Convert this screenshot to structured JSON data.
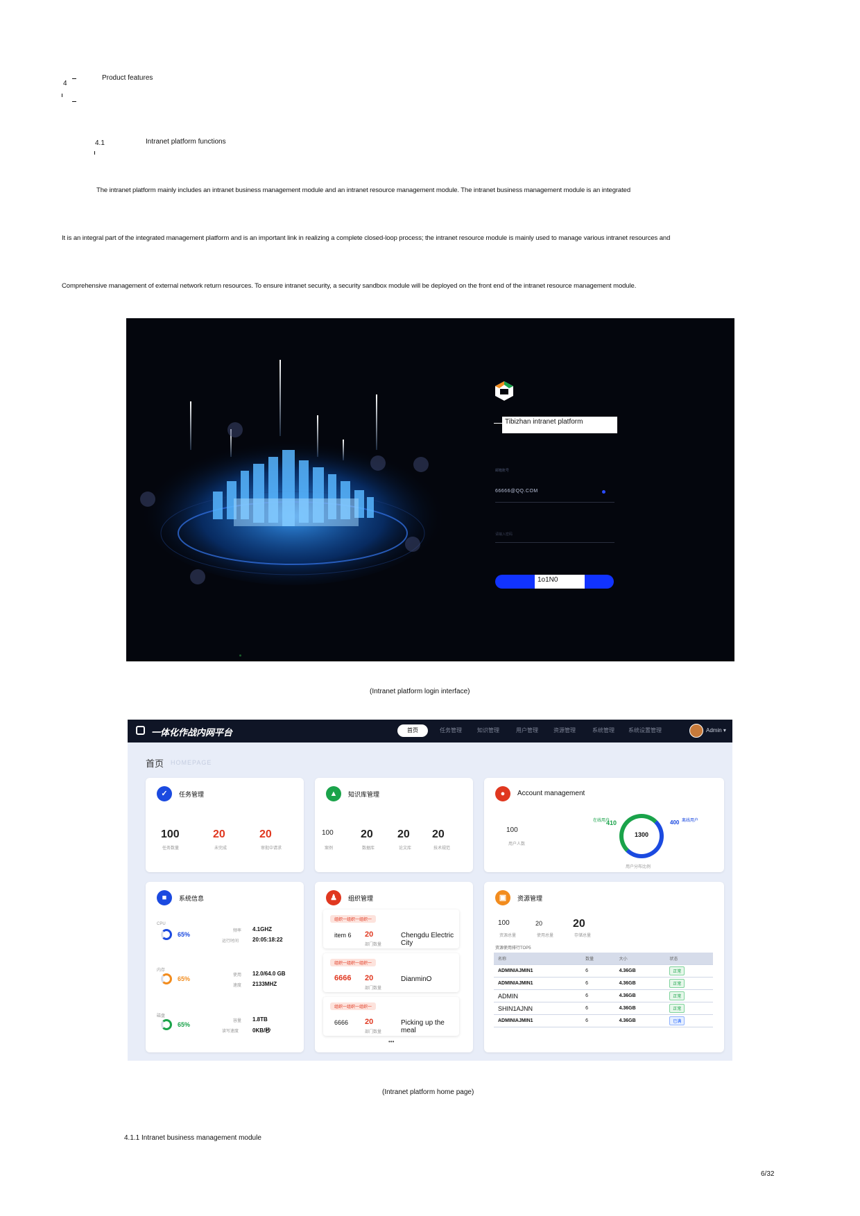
{
  "section4": {
    "number": "4",
    "title": "Product features"
  },
  "section41": {
    "number": "4.1",
    "title": "Intranet platform functions"
  },
  "paragraph": {
    "line1": "The intranet platform mainly includes an intranet business management module and an intranet resource management module. The intranet business management module is an integrated",
    "line2": "It is an integral part of the integrated management platform and is an important link in realizing a complete closed-loop process; the intranet resource module is mainly used to manage various intranet resources and",
    "line3": "Comprehensive management of external network return resources. To ensure intranet security, a security sandbox module will be deployed on the front end of the intranet resource management module."
  },
  "login": {
    "platform_name": "Tibizhan intranet platform",
    "email_value": "66666@QQ.COM",
    "button_label": "1o1N0",
    "caption": "(Intranet platform login interface)"
  },
  "dashboard": {
    "brand": "一体化作战内网平台",
    "nav": [
      "首页",
      "任务管理",
      "知识管理",
      "用户管理",
      "资源管理",
      "系统管理",
      "系统设置管理"
    ],
    "user": "Admin ▾",
    "page_title": "首页",
    "page_subtitle": "HOMEPAGE",
    "task": {
      "title": "任务管理",
      "v1": "100",
      "v2": "20",
      "v3": "20",
      "l1": "任务数量",
      "l2": "未完成",
      "l3": "审批中请求"
    },
    "knowledge": {
      "title": "知识库管理",
      "v1": "100",
      "v2": "20",
      "v3": "20",
      "v4": "20",
      "l1": "案例",
      "l2": "数据库",
      "l3": "论文库",
      "l4": "技术规范"
    },
    "account": {
      "title": "Account management",
      "v1": "100",
      "l1": "用户人数",
      "left_num": "410",
      "right_num": "400",
      "center": "1300",
      "ring_label": "用户分布比例",
      "left_tag": "在线用户",
      "right_tag": "离线用户"
    },
    "system": {
      "title": "系统信息",
      "cpu": "CPU",
      "mem": "内存",
      "disk": "磁盘",
      "pct1": "65%",
      "pct2": "65%",
      "pct3": "65%",
      "k1": "频率",
      "v1": "4.1GHZ",
      "k2": "运行时间",
      "v2": "20:05:18:22",
      "k3": "使用",
      "v3": "12.0/64.0 GB",
      "k4": "速度",
      "v4": "2133MHZ",
      "k5": "容量",
      "v5": "1.8TB",
      "k6": "读写速度",
      "v6": "0KB/秒"
    },
    "org": {
      "title": "组织管理",
      "tag1": "组织一组织一组织一",
      "a1": "item 6",
      "n1": "20",
      "name1": "Chengdu Electric City",
      "tag2": "组织一组织一组织一",
      "a2": "6666",
      "n2": "20",
      "name2": "DianminO",
      "tag3": "组织一组织一组织一",
      "a3": "6666",
      "n3": "20",
      "name3": "Picking up the meal",
      "sub": "部门数量",
      "more": "•••"
    },
    "resource": {
      "title": "资源管理",
      "v1": "100",
      "v2": "20",
      "v3": "20",
      "l1": "资源总量",
      "l2": "使用总量",
      "l3": "存储总量",
      "table_title": "资源使用排行TOP5",
      "headers": [
        "名称",
        "数量",
        "大小",
        "状态"
      ],
      "rows": [
        {
          "name": "ADMINIAJMIN1",
          "count": "6",
          "size": "4.36GB",
          "status": "正常"
        },
        {
          "name": "ADMINIAJMIN1",
          "count": "6",
          "size": "4.36GB",
          "status": "正常"
        },
        {
          "name": "ADMIN",
          "count": "6",
          "size": "4.36GB",
          "status": "正常"
        },
        {
          "name": "SHIN1AJNN",
          "count": "6",
          "size": "4.36GB",
          "status": "正常"
        },
        {
          "name": "ADMINIAJMIN1",
          "count": "6",
          "size": "4.36GB",
          "status": "已满"
        }
      ]
    },
    "caption": "(Intranet platform home page)"
  },
  "subsection": "4.1.1 Intranet business management module",
  "page_number": "6/32",
  "colors": {
    "accent_blue": "#1133ff",
    "dark_bg": "#04060d",
    "red": "#e0371f",
    "green": "#1aa34a"
  }
}
